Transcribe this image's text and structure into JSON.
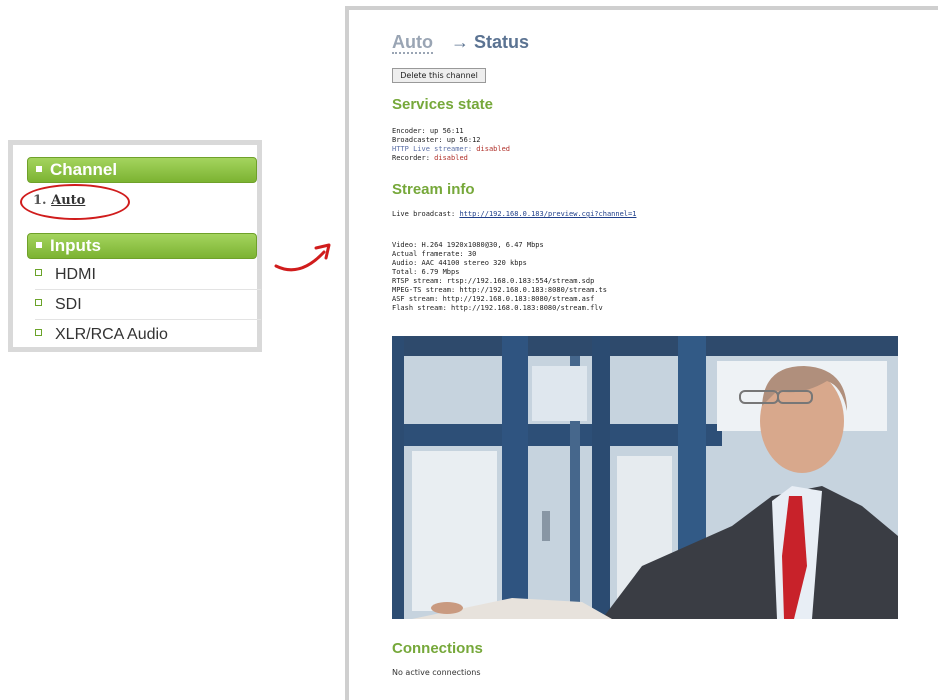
{
  "sidebar": {
    "channel_header": "Channel",
    "channel_item_num": "1.",
    "channel_item_label": "Auto",
    "inputs_header": "Inputs",
    "inputs": [
      "HDMI",
      "SDI",
      "XLR/RCA Audio"
    ]
  },
  "status": {
    "title_channel": "Auto",
    "title_page": "→ Status",
    "delete_button": "Delete this channel",
    "services_heading": "Services state",
    "services": {
      "encoder": "Encoder: up 56:11",
      "broadcaster": "Broadcaster: up 56:12",
      "hls_label": "HTTP Live streamer: ",
      "hls_value": "disabled",
      "recorder_label": "Recorder: ",
      "recorder_value": "disabled"
    },
    "stream_heading": "Stream info",
    "live_label": "Live broadcast: ",
    "live_link": "http://192.168.0.183/preview.cgi?channel=1",
    "stream_lines": [
      "Video: H.264 1920x1080@30, 6.47 Mbps",
      "Actual framerate: 30",
      "Audio: AAC 44100 stereo 320 kbps",
      "Total: 6.79 Mbps",
      "RTSP stream: rtsp://192.168.0.183:554/stream.sdp",
      "MPEG-TS stream: http://192.168.0.183:8080/stream.ts",
      "ASF stream: http://192.168.0.183:8080/stream.asf",
      "Flash stream: http://192.168.0.183:8080/stream.flv"
    ],
    "connections_heading": "Connections",
    "connections_text": "No active connections"
  },
  "colors": {
    "green_header": "#7cb332",
    "heading_green": "#76a83a",
    "circle_red": "#d01c1c",
    "title_blue": "#5b7392"
  }
}
